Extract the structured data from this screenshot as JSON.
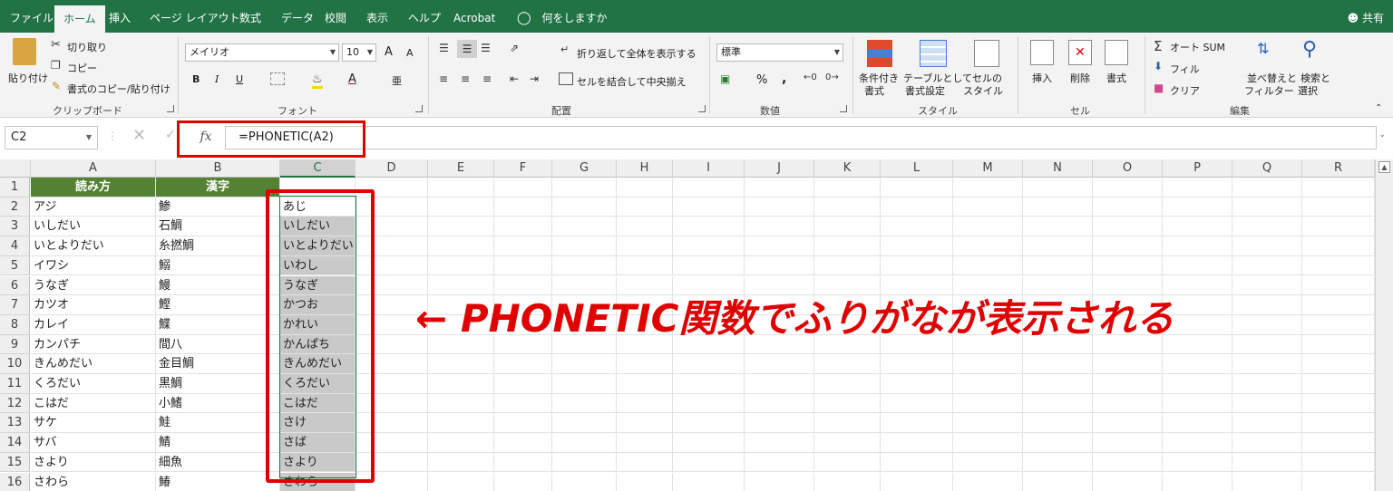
{
  "ribbon_tabs": [
    "ファイル",
    "ホーム",
    "挿入",
    "ページ レイアウト",
    "数式",
    "データ",
    "校閲",
    "表示",
    "ヘルプ",
    "Acrobat",
    "何をしますか"
  ],
  "share_label": "共有",
  "clipboard": {
    "paste": "貼り付け",
    "cut": "切り取り",
    "copy": "コピー",
    "format_painter": "書式のコピー/貼り付け",
    "group_label": "クリップボード"
  },
  "font": {
    "name": "メイリオ",
    "size": "10",
    "group_label": "フォント",
    "bold": "B",
    "italic": "I",
    "underline": "U",
    "grow": "A",
    "shrink": "A",
    "font_color_letter": "A",
    "phonetic": "亜"
  },
  "alignment": {
    "wrap_text": "折り返して全体を表示する",
    "merge_center": "セルを結合して中央揃え",
    "group_label": "配置"
  },
  "number": {
    "format": "標準",
    "percent": "%",
    "comma": ",",
    "group_label": "数値"
  },
  "styles": {
    "conditional_formatting": [
      "条件付き",
      "書式"
    ],
    "format_as_table": [
      "テーブルとして",
      "書式設定"
    ],
    "cell_styles": [
      "セルの",
      "スタイル"
    ],
    "group_label": "スタイル"
  },
  "cells": {
    "insert": "挿入",
    "delete": "削除",
    "format": "書式",
    "group_label": "セル"
  },
  "editing": {
    "autosum": "オート SUM",
    "fill": "フィル",
    "clear": "クリア",
    "sort_filter": [
      "並べ替えと",
      "フィルター"
    ],
    "find_select": [
      "検索と",
      "選択"
    ],
    "group_label": "編集"
  },
  "formula_bar": {
    "name_box": "C2",
    "fx": "fx",
    "formula": "=PHONETIC(A2)"
  },
  "columns": [
    "A",
    "B",
    "C",
    "D",
    "E",
    "F",
    "G",
    "H",
    "I",
    "J",
    "K",
    "L",
    "M",
    "N",
    "O",
    "P",
    "Q",
    "R"
  ],
  "header_row": [
    "読み方",
    "漢字",
    ""
  ],
  "rows": [
    [
      "アジ",
      "鯵",
      "あじ"
    ],
    [
      "いしだい",
      "石鯛",
      "いしだい"
    ],
    [
      "いとよりだい",
      "糸撚鯛",
      "いとよりだい"
    ],
    [
      "イワシ",
      "鰯",
      "いわし"
    ],
    [
      "うなぎ",
      "鰻",
      "うなぎ"
    ],
    [
      "カツオ",
      "鰹",
      "かつお"
    ],
    [
      "カレイ",
      "鰈",
      "かれい"
    ],
    [
      "カンパチ",
      "間八",
      "かんぱち"
    ],
    [
      "きんめだい",
      "金目鯛",
      "きんめだい"
    ],
    [
      "くろだい",
      "黒鯛",
      "くろだい"
    ],
    [
      "こはだ",
      "小鰭",
      "こはだ"
    ],
    [
      "サケ",
      "鮭",
      "さけ"
    ],
    [
      "サバ",
      "鯖",
      "さば"
    ],
    [
      "さより",
      "細魚",
      "さより"
    ],
    [
      "さわら",
      "鰆",
      "さわら"
    ]
  ],
  "annotation": "← PHONETIC関数でふりがなが表示される",
  "colors": {
    "excel_green": "#217346",
    "header_fill": "#548235",
    "highlight_red": "#e00000",
    "shade": "#c9c9c9"
  }
}
